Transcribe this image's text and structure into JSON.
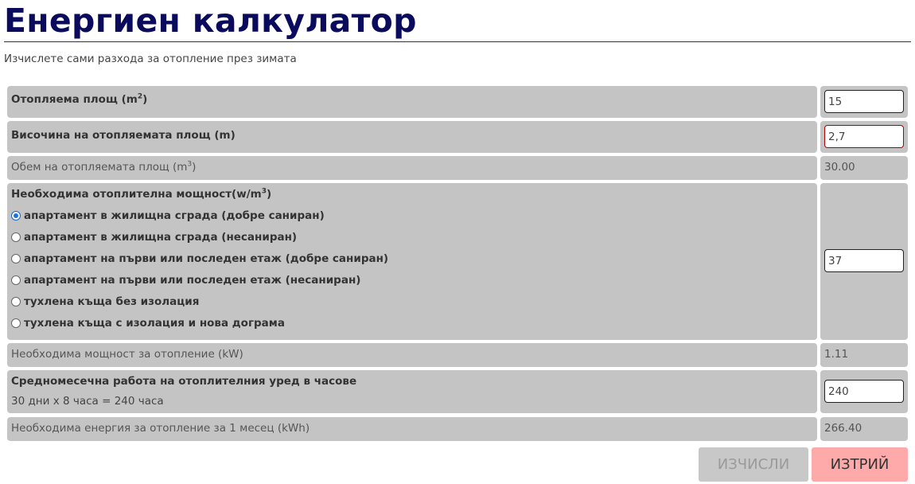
{
  "page": {
    "title": "Енергиен калкулатор",
    "subtitle": "Изчислете сами разхода за отопление през зимата"
  },
  "rows": {
    "area": {
      "label": "Отопляема площ (m",
      "sup": "2",
      "close": ")",
      "value": "15"
    },
    "height": {
      "label": "Височина на отопляемата площ (m)",
      "value": "2,7"
    },
    "volume": {
      "label": "Обем на отопляемата площ (m",
      "sup": "3",
      "close": ")",
      "value": "30.00"
    },
    "power_needed": {
      "label": "Необходима отоплителна мощност(w/m",
      "sup": "3",
      "close": ")",
      "value": "37",
      "options": [
        {
          "label": "апартамент в жилищна сграда (добре саниран)",
          "selected": true
        },
        {
          "label": "апартамент в жилищна сграда (несаниран)",
          "selected": false
        },
        {
          "label": "апартамент на първи или последен етаж (добре саниран)",
          "selected": false
        },
        {
          "label": "апартамент на първи или последен етаж (несаниран)",
          "selected": false
        },
        {
          "label": "тухлена къща без изолация",
          "selected": false
        },
        {
          "label": "тухлена къща с изолация и нова дограма",
          "selected": false
        }
      ]
    },
    "heating_power": {
      "label": "Необходима мощност за отопление (kW)",
      "value": "1.11"
    },
    "monthly_hours": {
      "label": "Средномесечна работа на отоплителния уред в часове",
      "hint": "30 дни х 8 часа = 240 часа",
      "value": "240"
    },
    "monthly_energy": {
      "label": "Необходима енергия за отопление за 1 месец (kWh)",
      "value": "266.40"
    }
  },
  "buttons": {
    "calculate": "ИЗЧИСЛИ",
    "clear": "ИЗТРИЙ"
  },
  "colors": {
    "title": "#0b0b5e",
    "cell_bg": "#c4c4c4",
    "clear_button": "#ffaaaa",
    "invalid_border": "#b00000"
  }
}
